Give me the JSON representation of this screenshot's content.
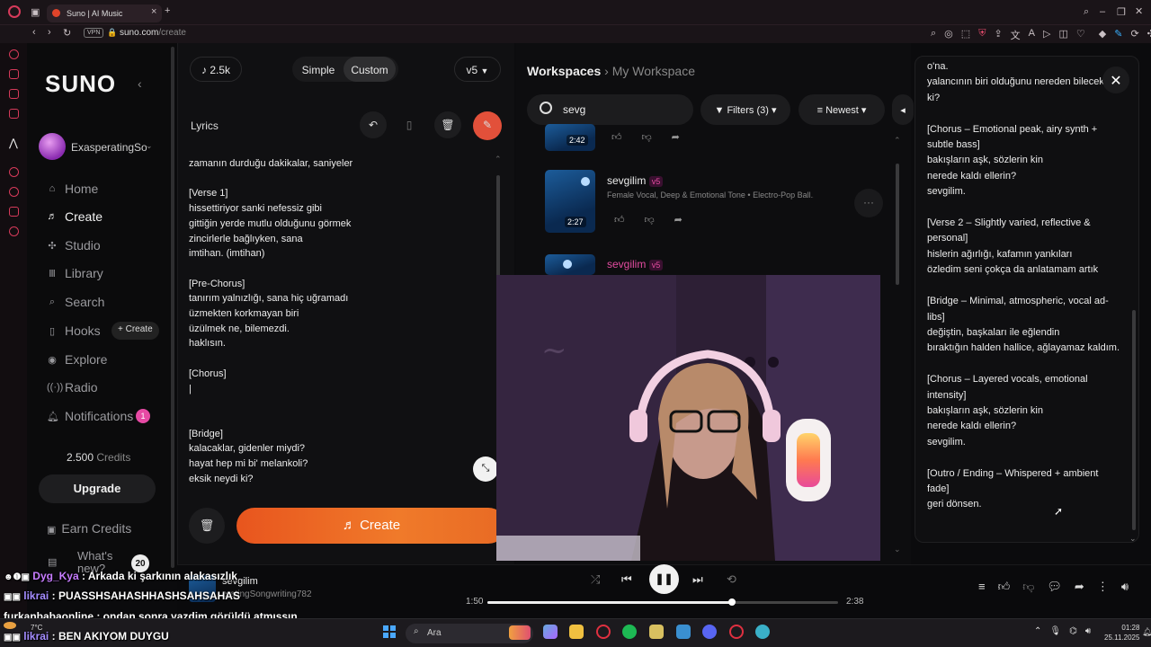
{
  "browser": {
    "tab_title": "Suno | AI Music",
    "url_domain": "suno.com",
    "url_path": "/create",
    "vpn_label": "VPN"
  },
  "sidebar": {
    "logo": "SUNO",
    "username": "ExasperatingSo",
    "nav": [
      {
        "label": "Home",
        "icon": "home-icon"
      },
      {
        "label": "Create",
        "icon": "create-icon",
        "active": true
      },
      {
        "label": "Studio",
        "icon": "studio-icon"
      },
      {
        "label": "Library",
        "icon": "library-icon"
      },
      {
        "label": "Search",
        "icon": "search-icon"
      },
      {
        "label": "Hooks",
        "icon": "hooks-icon"
      },
      {
        "label": "Explore",
        "icon": "explore-icon"
      },
      {
        "label": "Radio",
        "icon": "radio-icon"
      },
      {
        "label": "Notifications",
        "icon": "bell-icon"
      }
    ],
    "hooks_create_label": "+ Create",
    "notifications_count": "1",
    "credits_value": "2.500",
    "credits_label": "Credits",
    "upgrade_label": "Upgrade",
    "earn_credits_label": "Earn Credits",
    "whats_new_label": "What's new?",
    "whats_new_count": "20"
  },
  "create_panel": {
    "song_count": "2.5k",
    "mode_simple": "Simple",
    "mode_custom": "Custom",
    "model_version": "v5",
    "lyrics_label": "Lyrics",
    "lyrics_text": "zamanın durduğu dakikalar, saniyeler\n\n[Verse 1]\nhissettiriyor sanki nefessiz gibi\ngittiğin yerde mutlu olduğunu görmek\nzincirlerle bağlıyken, sana\nimtihan. (imtihan)\n\n[Pre-Chorus]\ntanırım yalnızlığı, sana hiç uğramadı\nüzmekten korkmayan biri\nüzülmek ne, bilemezdi.\nhaklısın.\n\n[Chorus]\n|\n\n\n[Bridge]\nkalacaklar, gidenler miydi?\nhayat hep mi bi' melankoli?\neksik neydi ki?",
    "create_label": "Create"
  },
  "workspace": {
    "title": "Workspaces",
    "current": "My Workspace",
    "search_value": "sevg",
    "filters_label": "Filters (3)",
    "sort_label": "Newest",
    "songs": [
      {
        "title": "",
        "duration": "2:42",
        "version": "",
        "meta": ""
      },
      {
        "title": "sevgilim",
        "duration": "2:27",
        "version": "v5",
        "meta": "Female Vocal, Deep & Emotional Tone • Electro-Pop Ball..."
      },
      {
        "title": "sevgilim",
        "duration": "",
        "version": "v5",
        "meta": ""
      }
    ]
  },
  "right_lyrics": {
    "text": "o'na.\nyalancının biri olduğunu nereden bilecektim ki?\n\n[Chorus – Emotional peak, airy synth + subtle bass]\nbakışların aşk, sözlerin kin\nnerede kaldı ellerin?\nsevgilim.\n\n[Verse 2 – Slightly varied, reflective & personal]\nhislerin ağırlığı, kafamın yankıları\nözledim seni çokça da anlatamam artık\n\n[Bridge – Minimal, atmospheric, vocal ad-libs]\ndeğiştin, başkaları ile eğlendin\nbıraktığın halden hallice, ağlayamaz kaldım.\n\n[Chorus – Layered vocals, emotional intensity]\nbakışların aşk, sözlerin kin\nnerede kaldı ellerin?\nsevgilim.\n\n[Outro / Ending – Whispered + ambient fade]\ngeri dönsen."
  },
  "player": {
    "track_title": "sevgilim",
    "track_artist": "eratingSongwriting782",
    "time_current": "1:50",
    "time_total": "2:38",
    "progress": 0.697
  },
  "chat": [
    {
      "user": "Dyg_Kya",
      "message": " : Arkada ki şarkının alakasızlık"
    },
    {
      "user": "likrai",
      "message": " : PUASSHSAHASHHASHSAHSAHAS"
    },
    {
      "user": "furkanbabaonline",
      "message": " : ondan sonra yazdim görüldü atmışsın"
    },
    {
      "user": "likrai",
      "message": " : BEN AKIYOM DUYGU"
    }
  ],
  "taskbar": {
    "search_label": "Ara",
    "weather_temp": "7°C",
    "time": "01:28",
    "date": "25.11.2025"
  }
}
